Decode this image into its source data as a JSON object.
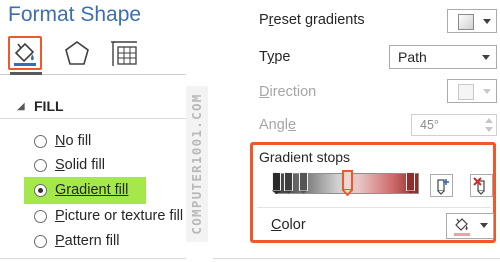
{
  "pane": {
    "title": "Format Shape"
  },
  "tabs": [
    {
      "id": "fill-line",
      "icon": "paint-bucket-icon",
      "selected": true
    },
    {
      "id": "effects",
      "icon": "pentagon-icon",
      "selected": false
    },
    {
      "id": "size-properties",
      "icon": "size-grid-icon",
      "selected": false
    }
  ],
  "fill": {
    "header": "FILL",
    "options": [
      {
        "label": "No fill",
        "accel": "N",
        "rest": "o fill",
        "checked": false
      },
      {
        "label": "Solid fill",
        "accel": "S",
        "rest": "olid fill",
        "checked": false
      },
      {
        "label": "Gradient fill",
        "accel": "G",
        "rest": "radient fill",
        "checked": true
      },
      {
        "label": "Picture or texture fill",
        "accel": "P",
        "rest": "icture or texture fill",
        "checked": false
      },
      {
        "label": "Pattern fill",
        "accel": "P",
        "rest": "attern fill",
        "checked": false
      }
    ]
  },
  "watermark": "COMPUTER1001.COM",
  "gradient": {
    "preset_label": "Preset gradients",
    "preset_accel": "r",
    "type_label": "Type",
    "type_accel": "y",
    "type_value": "Path",
    "direction_label": "Direction",
    "direction_accel": "D",
    "angle_label": "Angle",
    "angle_accel": "e",
    "angle_value": "45°",
    "stops_label": "Gradient stops",
    "color_label": "Color",
    "color_accel": "C"
  },
  "colors": {
    "accent_highlight": "#f0582b",
    "selection_green": "#a5e84b",
    "title_blue": "#3c6fb0"
  }
}
